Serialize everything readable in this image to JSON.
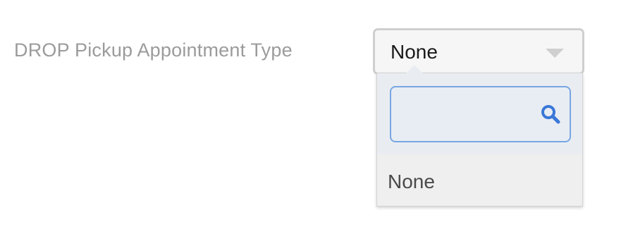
{
  "form": {
    "label": "DROP Pickup Appointment Type",
    "select": {
      "selected_value": "None",
      "arrow_icon": "chevron-down-icon"
    }
  },
  "dropdown": {
    "search": {
      "value": "",
      "placeholder": "",
      "icon": "search-icon"
    },
    "options": [
      {
        "label": "None"
      }
    ]
  },
  "colors": {
    "label_text": "#9b9b9b",
    "select_border": "#cfcfcf",
    "search_focus_border": "#78a6e3",
    "search_icon": "#3a78d8",
    "dropdown_bg": "#efefef",
    "search_area_bg": "#e9edf2"
  }
}
